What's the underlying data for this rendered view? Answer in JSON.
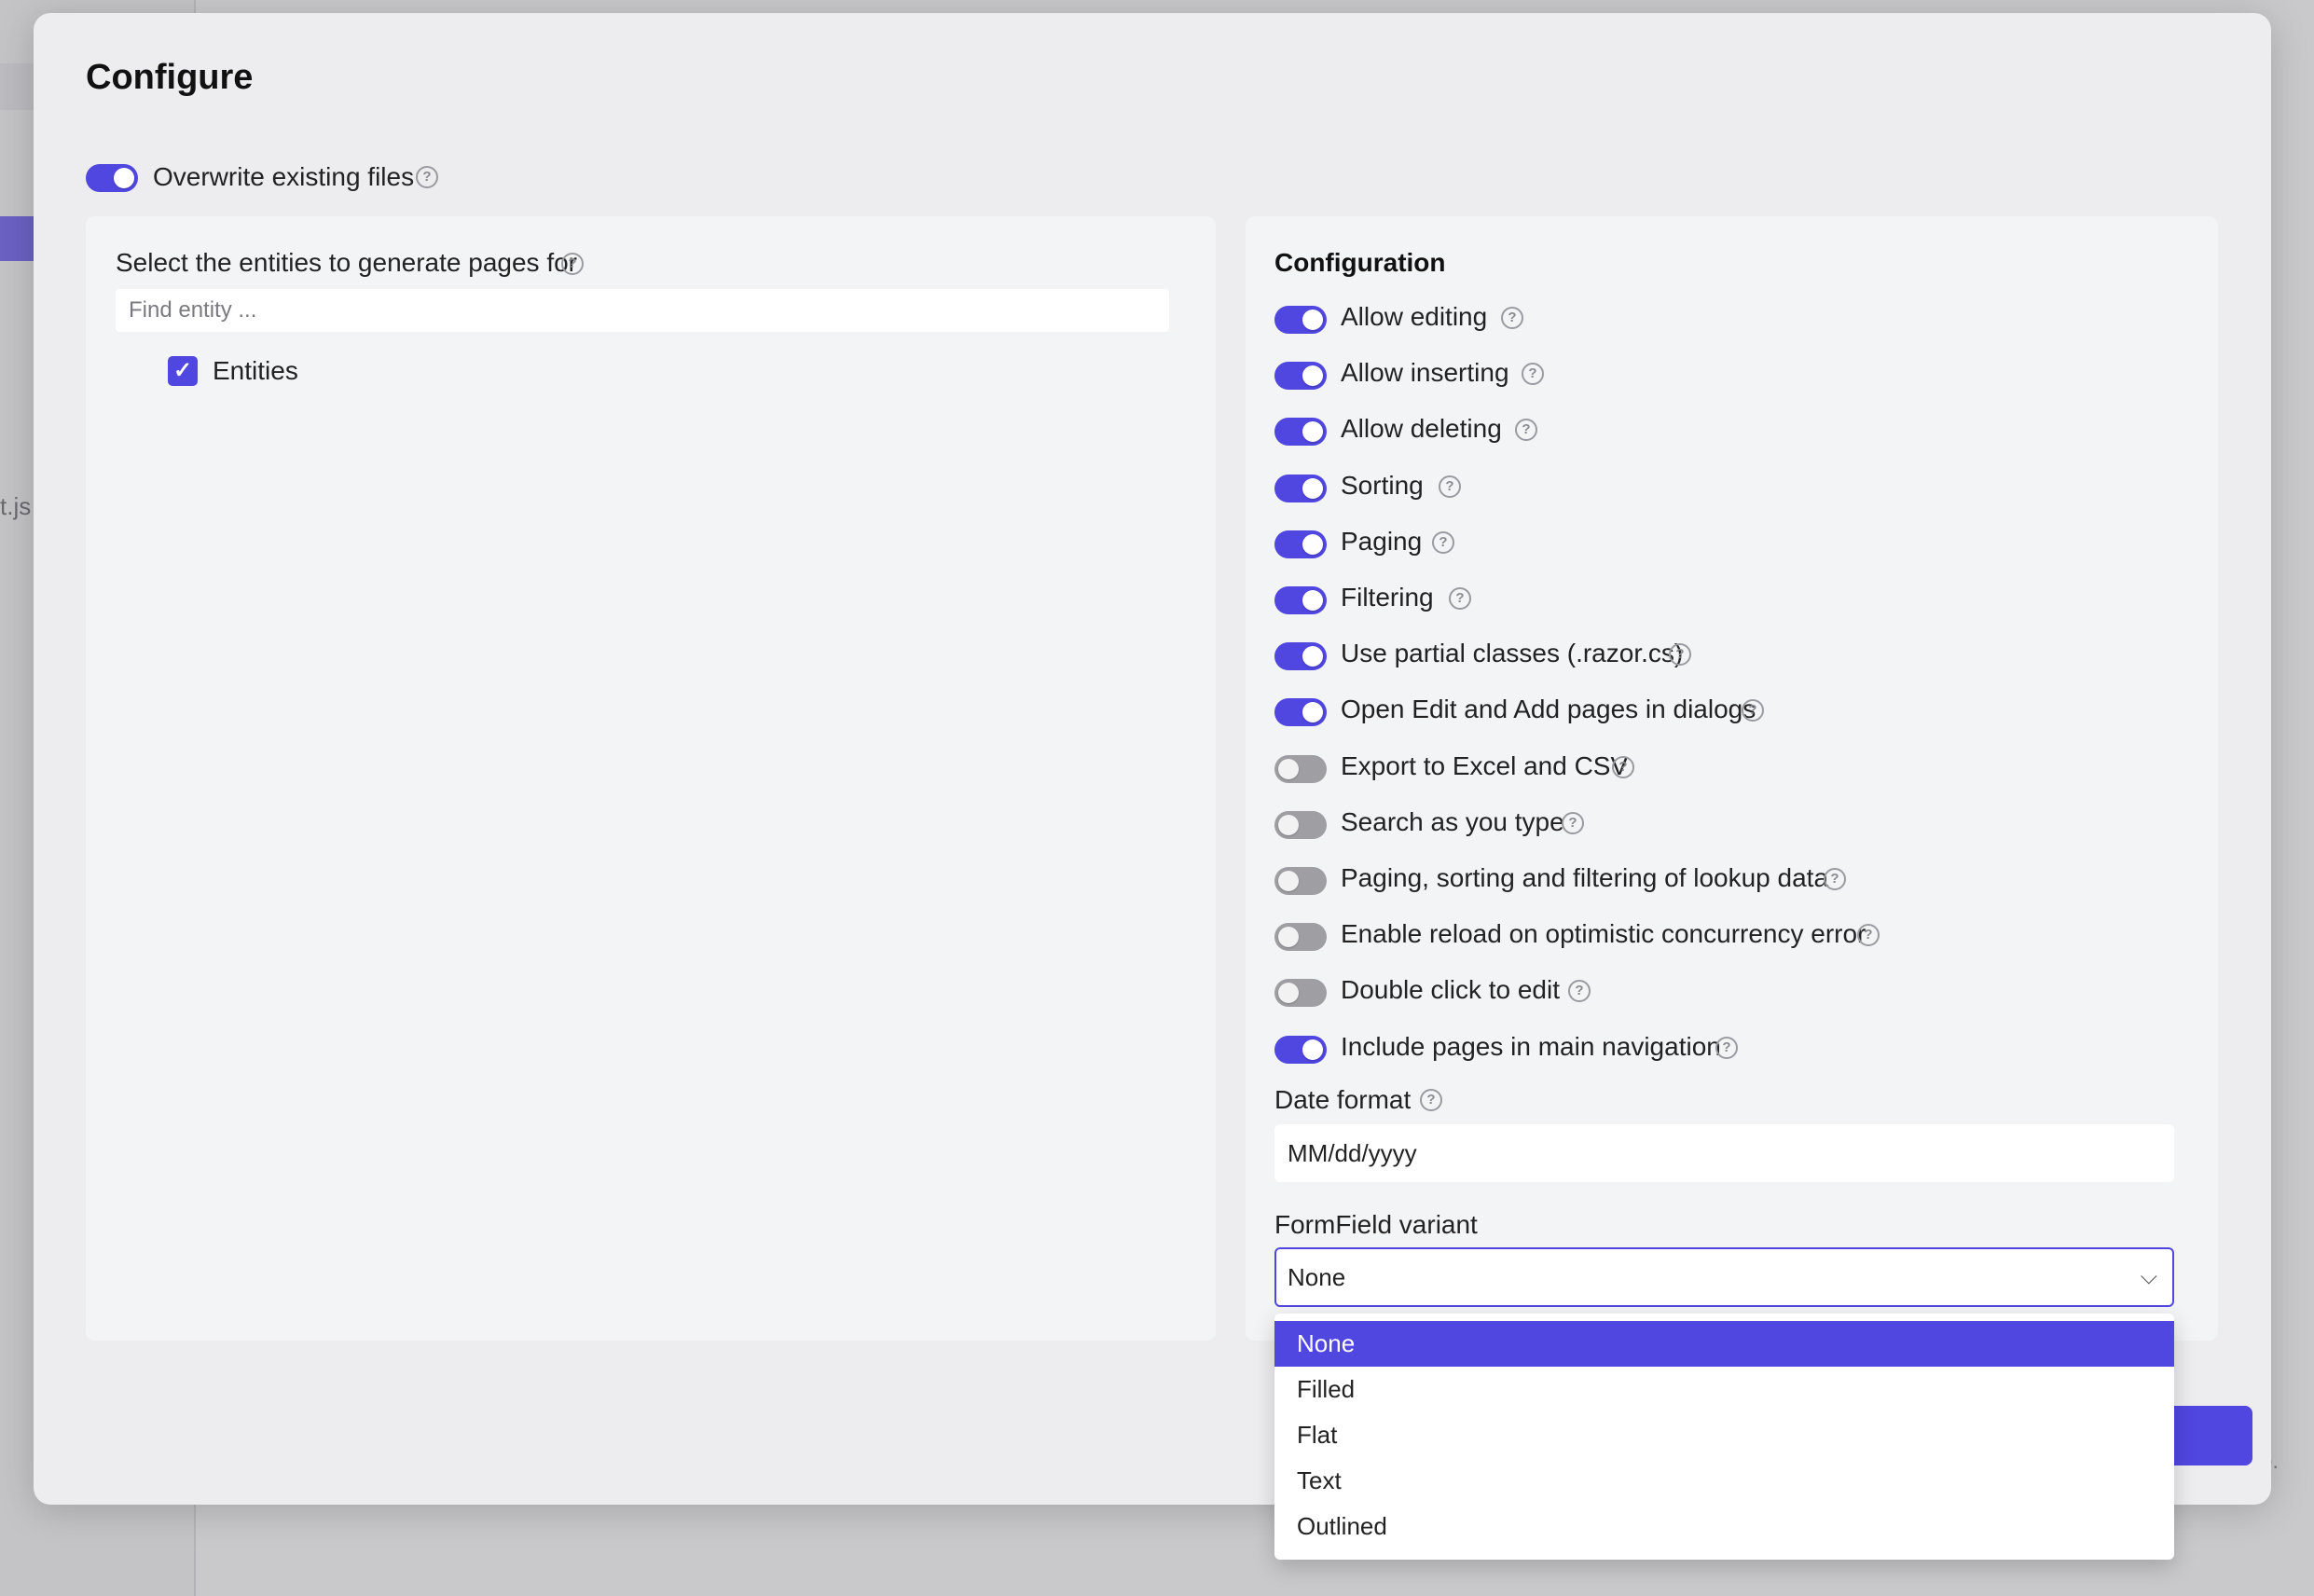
{
  "background": {
    "fragment_left": "t.js",
    "fragment_right": "o."
  },
  "dialog": {
    "title": "Configure",
    "overwrite": {
      "label": "Overwrite existing files",
      "checked": true
    }
  },
  "entities_panel": {
    "title": "Select the entities to generate pages for",
    "search_placeholder": "Find entity ...",
    "items": [
      {
        "label": "Entities",
        "checked": true
      }
    ]
  },
  "configuration": {
    "title": "Configuration",
    "toggles": [
      {
        "label": "Allow editing",
        "on": true
      },
      {
        "label": "Allow inserting",
        "on": true
      },
      {
        "label": "Allow deleting",
        "on": true
      },
      {
        "label": "Sorting",
        "on": true
      },
      {
        "label": "Paging",
        "on": true
      },
      {
        "label": "Filtering",
        "on": true
      },
      {
        "label": "Use partial classes (.razor.cs)",
        "on": true
      },
      {
        "label": "Open Edit and Add pages in dialogs",
        "on": true
      },
      {
        "label": "Export to Excel and CSV",
        "on": false
      },
      {
        "label": "Search as you type",
        "on": false
      },
      {
        "label": "Paging, sorting and filtering of lookup data",
        "on": false
      },
      {
        "label": "Enable reload on optimistic concurrency error",
        "on": false
      },
      {
        "label": "Double click to edit",
        "on": false
      },
      {
        "label": "Include pages in main navigation",
        "on": true
      }
    ],
    "date_format": {
      "label": "Date format",
      "value": "MM/dd/yyyy"
    },
    "formfield_variant": {
      "label": "FormField variant",
      "value": "None",
      "options": [
        "None",
        "Filled",
        "Flat",
        "Text",
        "Outlined"
      ],
      "selected_index": 0
    }
  },
  "colors": {
    "accent": "#5046e0",
    "dialog_bg": "#ededef",
    "panel_bg": "#f3f4f6"
  }
}
